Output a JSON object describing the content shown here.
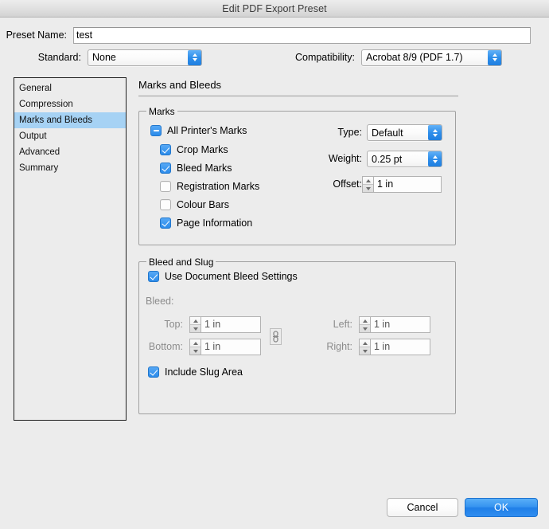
{
  "window": {
    "title": "Edit PDF Export Preset"
  },
  "top_fields": {
    "preset_name_label": "Preset Name:",
    "preset_name_value": "test",
    "preset_name_placeholder": "",
    "standard_label": "Standard:",
    "standard_value": "None",
    "compatibility_label": "Compatibility:",
    "compatibility_value": "Acrobat 8/9 (PDF 1.7)"
  },
  "sidebar": {
    "items": [
      {
        "label": "General",
        "selected": false
      },
      {
        "label": "Compression",
        "selected": false
      },
      {
        "label": "Marks and Bleeds",
        "selected": true
      },
      {
        "label": "Output",
        "selected": false
      },
      {
        "label": "Advanced",
        "selected": false
      },
      {
        "label": "Summary",
        "selected": false
      }
    ],
    "selection_color": "#a6d2f4"
  },
  "panel": {
    "title": "Marks and Bleeds"
  },
  "marks": {
    "group_title": "Marks",
    "checkboxes": [
      {
        "label": "All Printer's Marks",
        "state": "mixed"
      },
      {
        "label": "Crop Marks",
        "state": "on"
      },
      {
        "label": "Bleed Marks",
        "state": "on"
      },
      {
        "label": "Registration Marks",
        "state": "off"
      },
      {
        "label": "Colour Bars",
        "state": "off"
      },
      {
        "label": "Page Information",
        "state": "on"
      }
    ],
    "type_label": "Type:",
    "type_value": "Default",
    "weight_label": "Weight:",
    "weight_value": "0.25 pt",
    "offset_label": "Offset:",
    "offset_value": "1 in"
  },
  "bleed_and_slug": {
    "group_title": "Bleed and Slug",
    "use_document_bleed_label": "Use Document Bleed Settings",
    "use_document_bleed_state": "on",
    "bleed_label": "Bleed:",
    "fields": [
      {
        "label": "Top:",
        "value": "1 in"
      },
      {
        "label": "Bottom:",
        "value": "1 in"
      },
      {
        "label": "Left:",
        "value": "1 in"
      },
      {
        "label": "Right:",
        "value": "1 in"
      }
    ],
    "link_icon": "chain-link-icon",
    "include_slug_label": "Include Slug Area",
    "include_slug_state": "on"
  },
  "footer": {
    "cancel_label": "Cancel",
    "ok_label": "OK",
    "ok_color": "#2f8def"
  }
}
